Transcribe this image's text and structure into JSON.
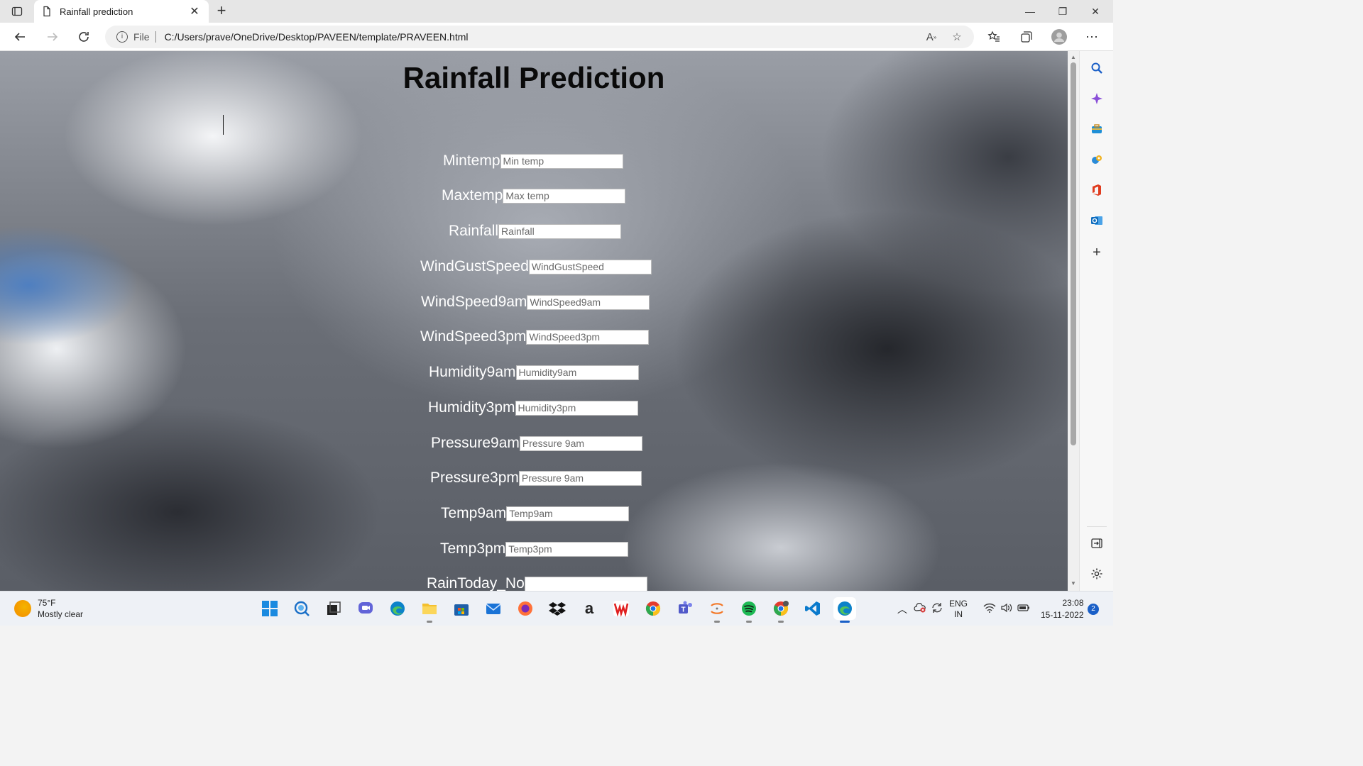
{
  "browser": {
    "tab_title": "Rainfall prediction",
    "tab_close": "✕",
    "new_tab": "+",
    "address": {
      "scheme_label": "File",
      "url": "C:/Users/prave/OneDrive/Desktop/PAVEEN/template/PRAVEEN.html"
    },
    "window_controls": {
      "minimize": "—",
      "restore": "❐",
      "close": "✕"
    }
  },
  "page": {
    "title": "Rainfall Prediction",
    "fields": [
      {
        "label": "Mintemp",
        "placeholder": "Min temp",
        "value": ""
      },
      {
        "label": "Maxtemp",
        "placeholder": "Max temp",
        "value": ""
      },
      {
        "label": "Rainfall",
        "placeholder": "Rainfall",
        "value": ""
      },
      {
        "label": "WindGustSpeed",
        "placeholder": "WindGustSpeed",
        "value": ""
      },
      {
        "label": "WindSpeed9am",
        "placeholder": "WindSpeed9am",
        "value": ""
      },
      {
        "label": "WindSpeed3pm",
        "placeholder": "WindSpeed3pm",
        "value": ""
      },
      {
        "label": "Humidity9am",
        "placeholder": "Humidity9am",
        "value": ""
      },
      {
        "label": "Humidity3pm",
        "placeholder": "Humidity3pm",
        "value": ""
      },
      {
        "label": "Pressure9am",
        "placeholder": "Pressure 9am",
        "value": ""
      },
      {
        "label": "Pressure3pm",
        "placeholder": "Pressure 9am",
        "value": ""
      },
      {
        "label": "Temp9am",
        "placeholder": "Temp9am",
        "value": ""
      },
      {
        "label": "Temp3pm",
        "placeholder": "Temp3pm",
        "value": ""
      },
      {
        "label": "RainToday_No",
        "placeholder": "",
        "value": ""
      }
    ]
  },
  "sidebar": {
    "items": [
      "search-icon",
      "copilot-icon",
      "tools-icon",
      "games-icon",
      "office-icon",
      "outlook-icon",
      "add-icon",
      "split-screen-icon",
      "settings-icon"
    ]
  },
  "taskbar": {
    "weather": {
      "temp": "75°F",
      "condition": "Mostly clear"
    },
    "apps": [
      "start-icon",
      "search-icon",
      "task-view-icon",
      "teams-chat-icon",
      "edge-icon",
      "file-explorer-icon",
      "store-icon",
      "mail-icon",
      "firefox-icon",
      "dropbox-icon",
      "amazon-icon",
      "wps-icon",
      "chrome-icon",
      "teams-icon",
      "jupyter-icon",
      "spotify-icon",
      "chrome-profile-icon",
      "vscode-icon",
      "edge-active-icon"
    ],
    "tray": {
      "language": "ENG",
      "region": "IN"
    },
    "clock": {
      "time": "23:08",
      "date": "15-11-2022"
    },
    "notifications": "2"
  },
  "colors": {
    "accent": "#1a5fc7",
    "title": "#0a0a0a",
    "label": "#ffffff"
  }
}
